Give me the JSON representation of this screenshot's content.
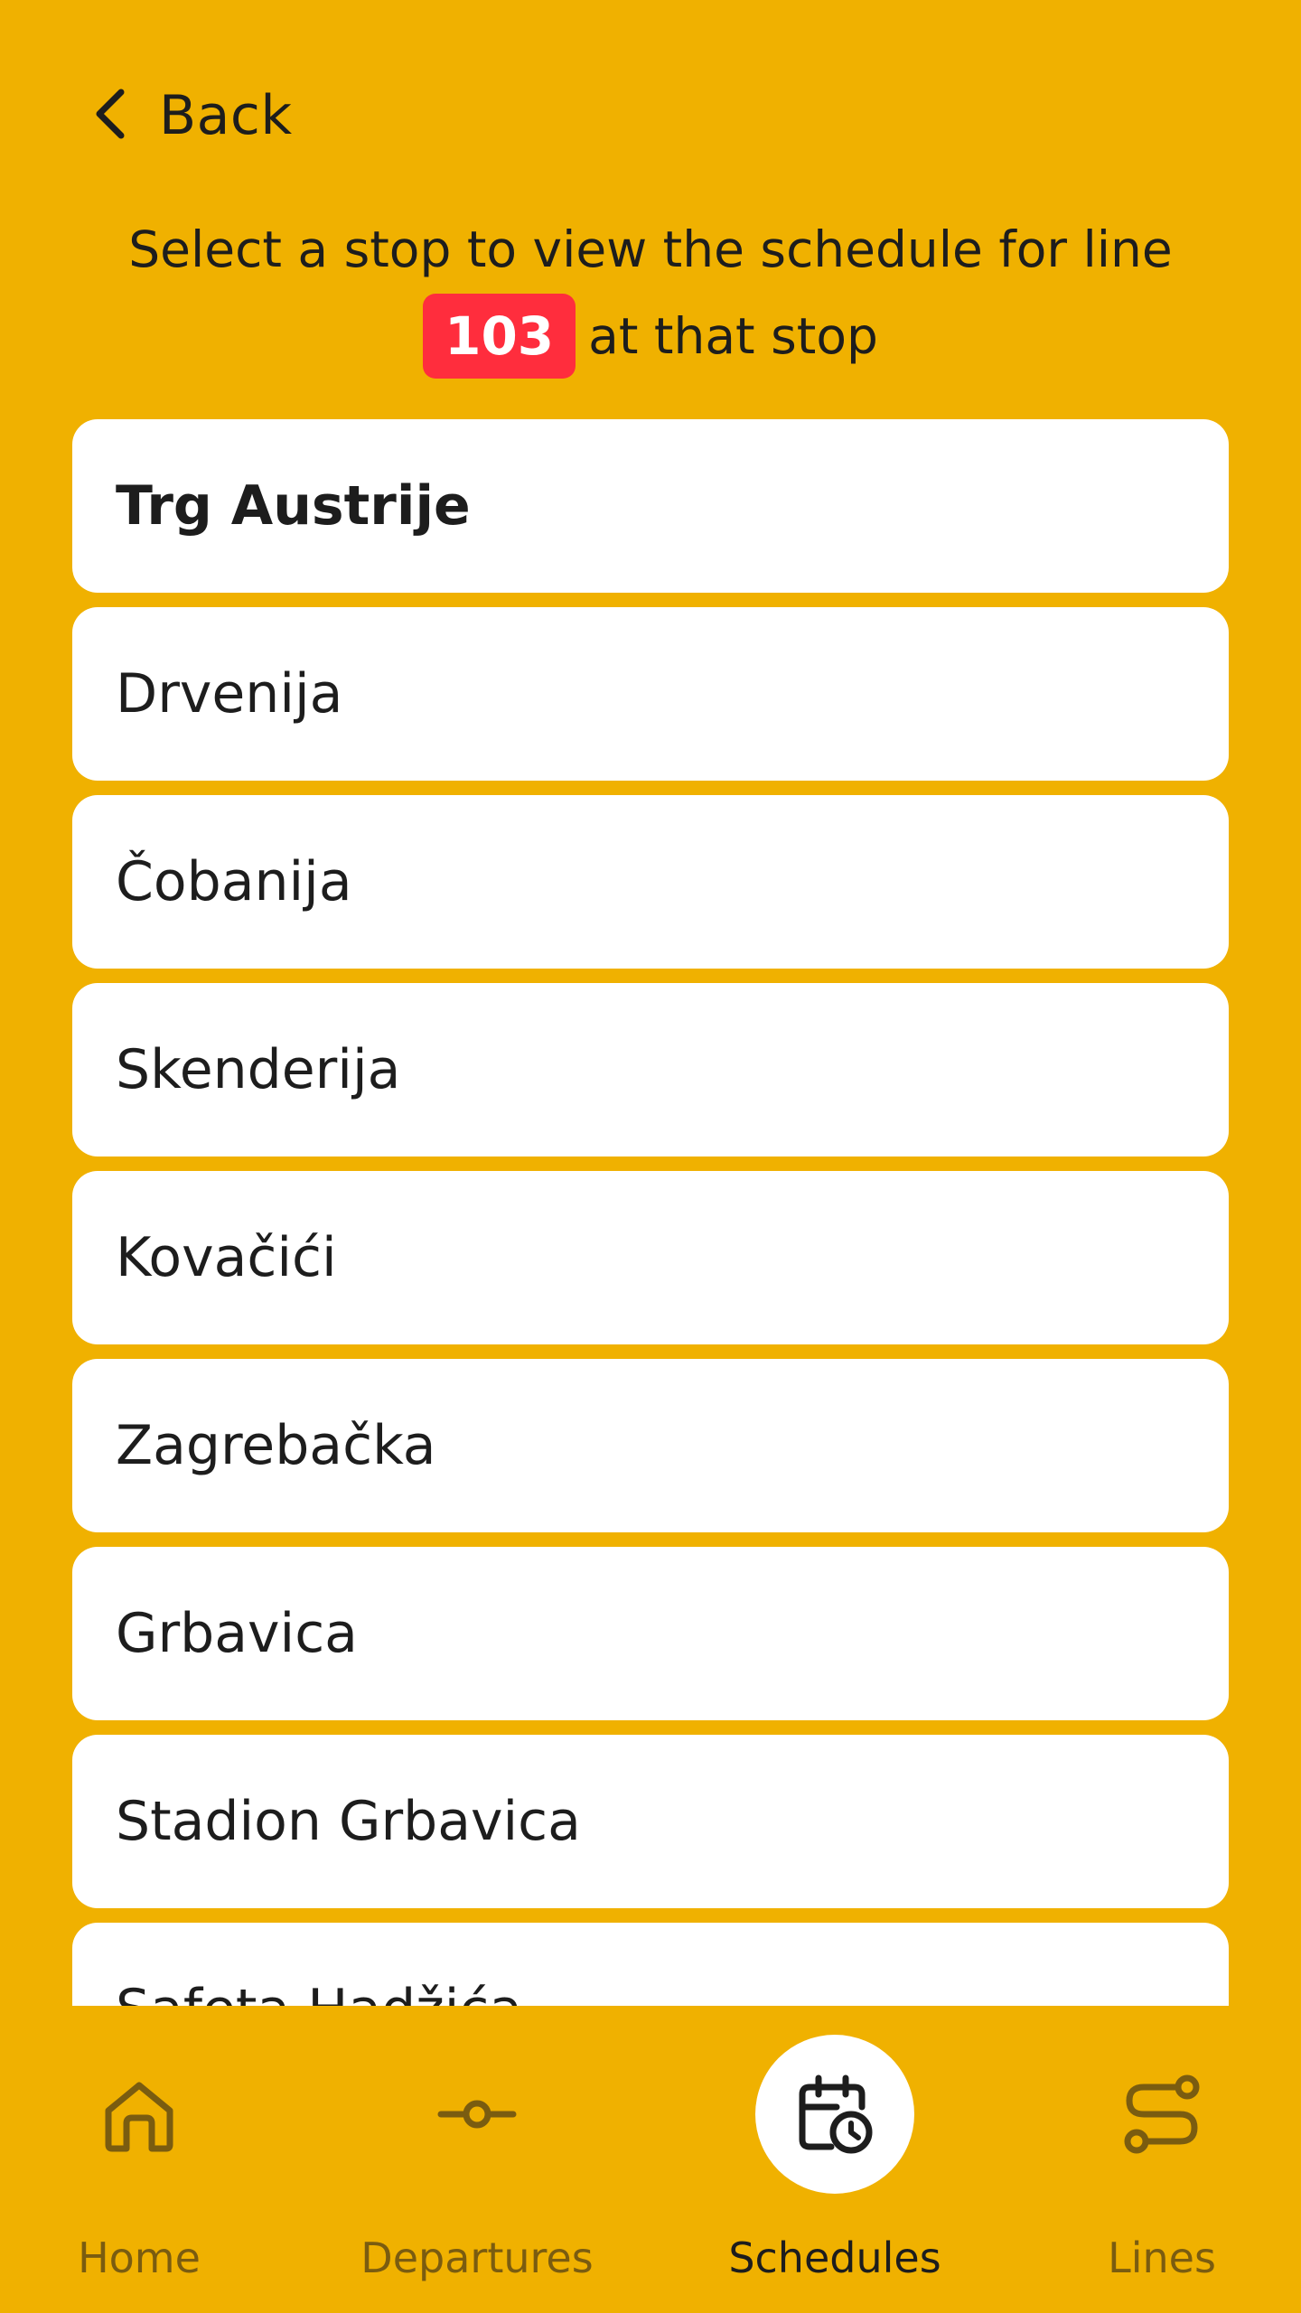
{
  "header": {
    "back_label": "Back",
    "intro_before": "Select a stop to view the schedule for line",
    "line_number": "103",
    "intro_after": "at that stop",
    "badge_color": "#FF2D3D"
  },
  "stops": [
    "Trg Austrije",
    "Drvenija",
    "Čobanija",
    "Skenderija",
    "Kovačići",
    "Zagrebačka",
    "Grbavica",
    "Stadion Grbavica",
    "Safeta Hadžića"
  ],
  "nav": {
    "home": "Home",
    "departures": "Departures",
    "schedules": "Schedules",
    "lines": "Lines",
    "active": "schedules"
  },
  "colors": {
    "background": "#F0B100",
    "card": "#FFFFFF",
    "text": "#1D1D1D",
    "inactive_nav": "#7A5C10"
  }
}
